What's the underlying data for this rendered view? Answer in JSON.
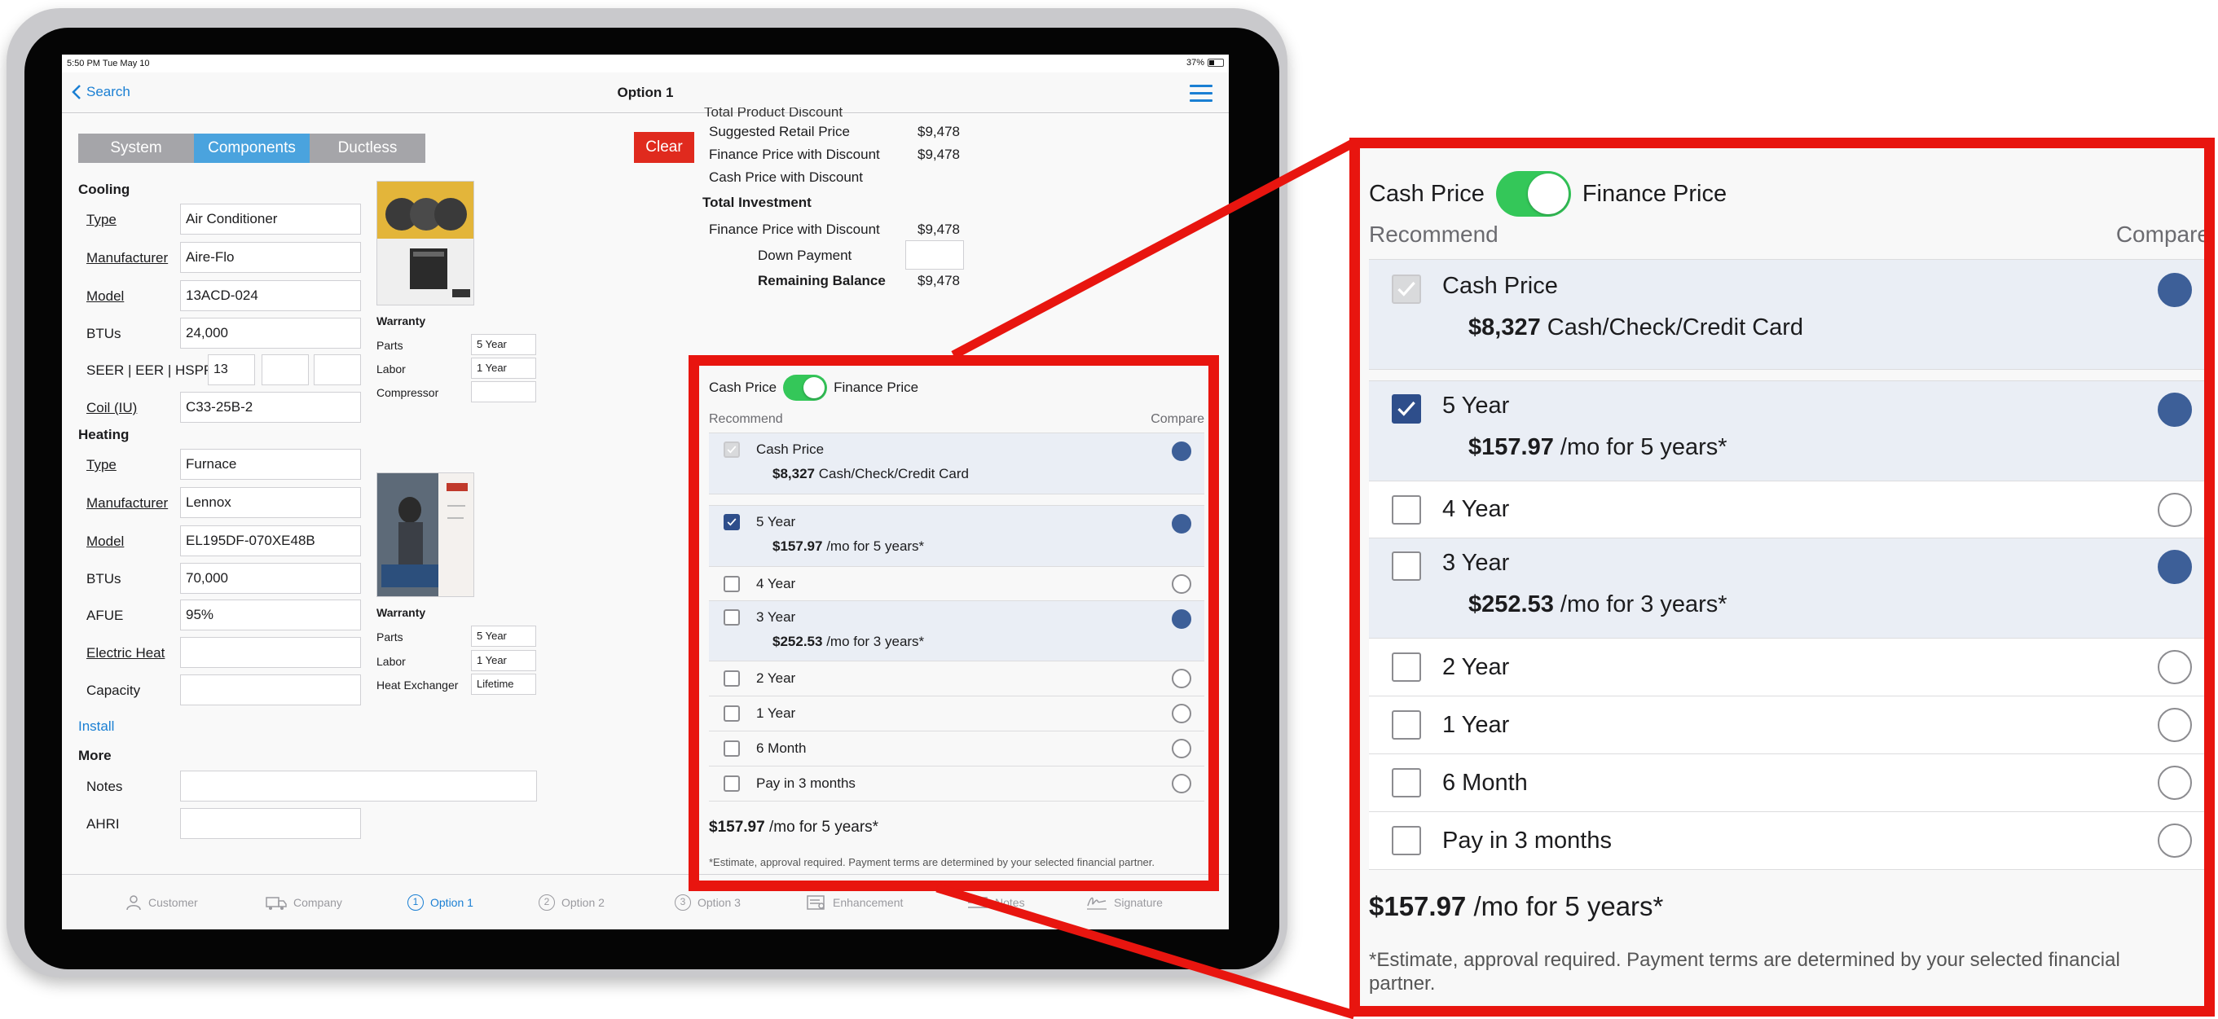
{
  "status": {
    "time": "5:50 PM  Tue May 10",
    "battery": "37%"
  },
  "nav": {
    "back_label": "Search",
    "title": "Option 1"
  },
  "segments": [
    "System",
    "Components",
    "Ductless"
  ],
  "clear_label": "Clear",
  "cooling": {
    "heading": "Cooling",
    "type_label": "Type",
    "type_value": "Air Conditioner",
    "manufacturer_label": "Manufacturer",
    "manufacturer_value": "Aire-Flo",
    "model_label": "Model",
    "model_value": "13ACD-024",
    "btus_label": "BTUs",
    "btus_value": "24,000",
    "seer_label": "SEER | EER | HSPF",
    "seer_value": "13",
    "coil_label": "Coil (IU)",
    "coil_value": "C33-25B-2",
    "warranty_title": "Warranty",
    "warranty": [
      {
        "label": "Parts",
        "value": "5 Year"
      },
      {
        "label": "Labor",
        "value": "1 Year"
      },
      {
        "label": "Compressor",
        "value": ""
      }
    ]
  },
  "heating": {
    "heading": "Heating",
    "type_label": "Type",
    "type_value": "Furnace",
    "manufacturer_label": "Manufacturer",
    "manufacturer_value": "Lennox",
    "model_label": "Model",
    "model_value": "EL195DF-070XE48B",
    "btus_label": "BTUs",
    "btus_value": "70,000",
    "afue_label": "AFUE",
    "afue_value": "95%",
    "electric_label": "Electric Heat",
    "electric_value": "",
    "capacity_label": "Capacity",
    "capacity_value": "",
    "warranty_title": "Warranty",
    "warranty": [
      {
        "label": "Parts",
        "value": "5 Year"
      },
      {
        "label": "Labor",
        "value": "1 Year"
      },
      {
        "label": "Heat Exchanger",
        "value": "Lifetime"
      }
    ]
  },
  "install_label": "Install",
  "more": {
    "heading": "More",
    "notes_label": "Notes",
    "ahri_label": "AHRI"
  },
  "pricing": {
    "cut_label": "Total Product Discount",
    "suggested_label": "Suggested Retail Price",
    "suggested_value": "$9,478",
    "finance_discount_label": "Finance Price with Discount",
    "finance_discount_value": "$9,478",
    "cash_discount_label": "Cash Price with Discount",
    "total_investment_label": "Total Investment",
    "ti_finance_label": "Finance Price with Discount",
    "ti_finance_value": "$9,478",
    "down_payment_label": "Down Payment",
    "remaining_label": "Remaining Balance",
    "remaining_value": "$9,478"
  },
  "options_panel": {
    "cash_label": "Cash Price",
    "finance_label": "Finance Price",
    "recommend_label": "Recommend",
    "compare_label": "Compare",
    "rows": [
      {
        "label": "Cash Price",
        "amount": "$8,327",
        "detail": "Cash/Check/Credit Card"
      },
      {
        "label": "5 Year",
        "amount": "$157.97",
        "detail": "/mo for 5 years*"
      },
      {
        "label": "4 Year"
      },
      {
        "label": "3 Year",
        "amount": "$252.53",
        "detail": "/mo for 3 years*"
      },
      {
        "label": "2 Year"
      },
      {
        "label": "1 Year"
      },
      {
        "label": "6 Month"
      },
      {
        "label": "Pay in 3 months"
      }
    ],
    "summary_amount": "$157.97",
    "summary_detail": "/mo for 5 years*",
    "disclaimer": "*Estimate, approval required. Payment terms are determined by your selected financial partner."
  },
  "tabs": [
    "Customer",
    "Company",
    "Option 1",
    "Option 2",
    "Option 3",
    "Enhancement",
    "Notes",
    "Signature"
  ],
  "tab_numbers": [
    "1",
    "2",
    "3"
  ],
  "colors": {
    "accent": "#1a7fd3",
    "highlight_red": "#e8150f",
    "toggle_green": "#34c759",
    "checked_blue": "#2e4e8b"
  }
}
